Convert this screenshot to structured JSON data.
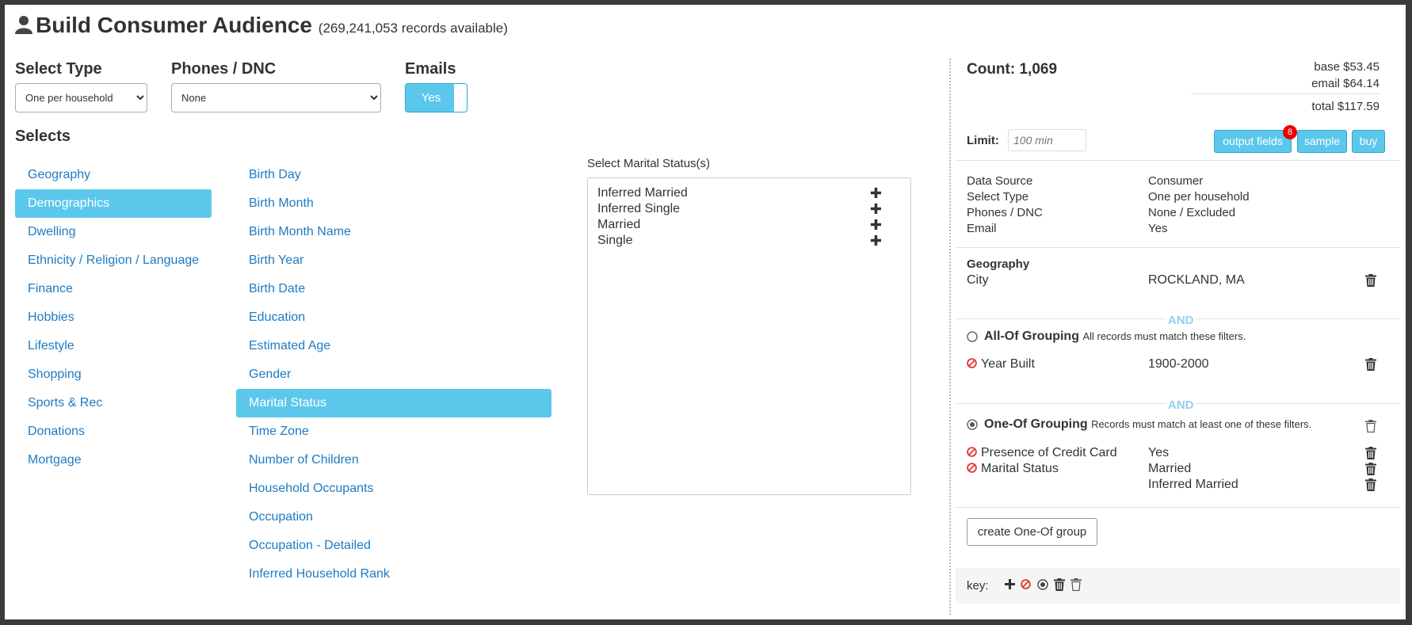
{
  "header": {
    "title": "Build Consumer Audience",
    "records_available": "(269,241,053 records available)"
  },
  "filters": {
    "select_type_label": "Select Type",
    "select_type_value": "One per household",
    "phones_label": "Phones / DNC",
    "phones_value": "None",
    "emails_label": "Emails",
    "emails_toggle": "Yes",
    "selects_label": "Selects"
  },
  "categories": [
    {
      "label": "Geography",
      "active": false
    },
    {
      "label": "Demographics",
      "active": true
    },
    {
      "label": "Dwelling",
      "active": false
    },
    {
      "label": "Ethnicity / Religion / Language",
      "active": false
    },
    {
      "label": "Finance",
      "active": false
    },
    {
      "label": "Hobbies",
      "active": false
    },
    {
      "label": "Lifestyle",
      "active": false
    },
    {
      "label": "Shopping",
      "active": false
    },
    {
      "label": "Sports & Rec",
      "active": false
    },
    {
      "label": "Donations",
      "active": false
    },
    {
      "label": "Mortgage",
      "active": false
    }
  ],
  "subcategories": [
    {
      "label": "Birth Day",
      "active": false
    },
    {
      "label": "Birth Month",
      "active": false
    },
    {
      "label": "Birth Month Name",
      "active": false
    },
    {
      "label": "Birth Year",
      "active": false
    },
    {
      "label": "Birth Date",
      "active": false
    },
    {
      "label": "Education",
      "active": false
    },
    {
      "label": "Estimated Age",
      "active": false
    },
    {
      "label": "Gender",
      "active": false
    },
    {
      "label": "Marital Status",
      "active": true
    },
    {
      "label": "Time Zone",
      "active": false
    },
    {
      "label": "Number of Children",
      "active": false
    },
    {
      "label": "Household Occupants",
      "active": false
    },
    {
      "label": "Occupation",
      "active": false
    },
    {
      "label": "Occupation - Detailed",
      "active": false
    },
    {
      "label": "Inferred Household Rank",
      "active": false
    }
  ],
  "marital": {
    "title": "Select Marital Status(s)",
    "options": [
      "Inferred Married",
      "Inferred Single",
      "Married",
      "Single"
    ],
    "add_icon": "plus-icon"
  },
  "summary": {
    "count": "Count: 1,069",
    "base": "base $53.45",
    "email": "email $64.14",
    "total": "total $117.59",
    "limit_label": "Limit:",
    "limit_placeholder": "100 min",
    "output_fields": "output fields",
    "output_badge": "8",
    "sample": "sample",
    "buy": "buy",
    "info": [
      {
        "key": "Data Source",
        "value": "Consumer"
      },
      {
        "key": "Select Type",
        "value": "One per household"
      },
      {
        "key": "Phones / DNC",
        "value": "None / Excluded"
      },
      {
        "key": "Email",
        "value": "Yes"
      }
    ],
    "geography_title": "Geography",
    "geography_key": "City",
    "geography_value": "ROCKLAND, MA",
    "and1": "AND",
    "allof_title": "All-Of Grouping",
    "allof_desc": "All records must match these filters.",
    "allof_key": "Year Built",
    "allof_value": "1900-2000",
    "and2": "AND",
    "oneof_title": "One-Of Grouping",
    "oneof_desc": "Records must match at least one of these filters.",
    "oneof_rows": [
      {
        "key": "Presence of Credit Card",
        "value": "Yes"
      },
      {
        "key": "Marital Status",
        "value": "Married"
      },
      {
        "key": "",
        "value": "Inferred Married"
      }
    ],
    "create_group": "create One-Of group",
    "key_label": "key:"
  },
  "colors": {
    "accent": "#5bc8eb",
    "link": "#1e7bc2",
    "ban": "#e53935",
    "and": "#8fd0ee"
  }
}
